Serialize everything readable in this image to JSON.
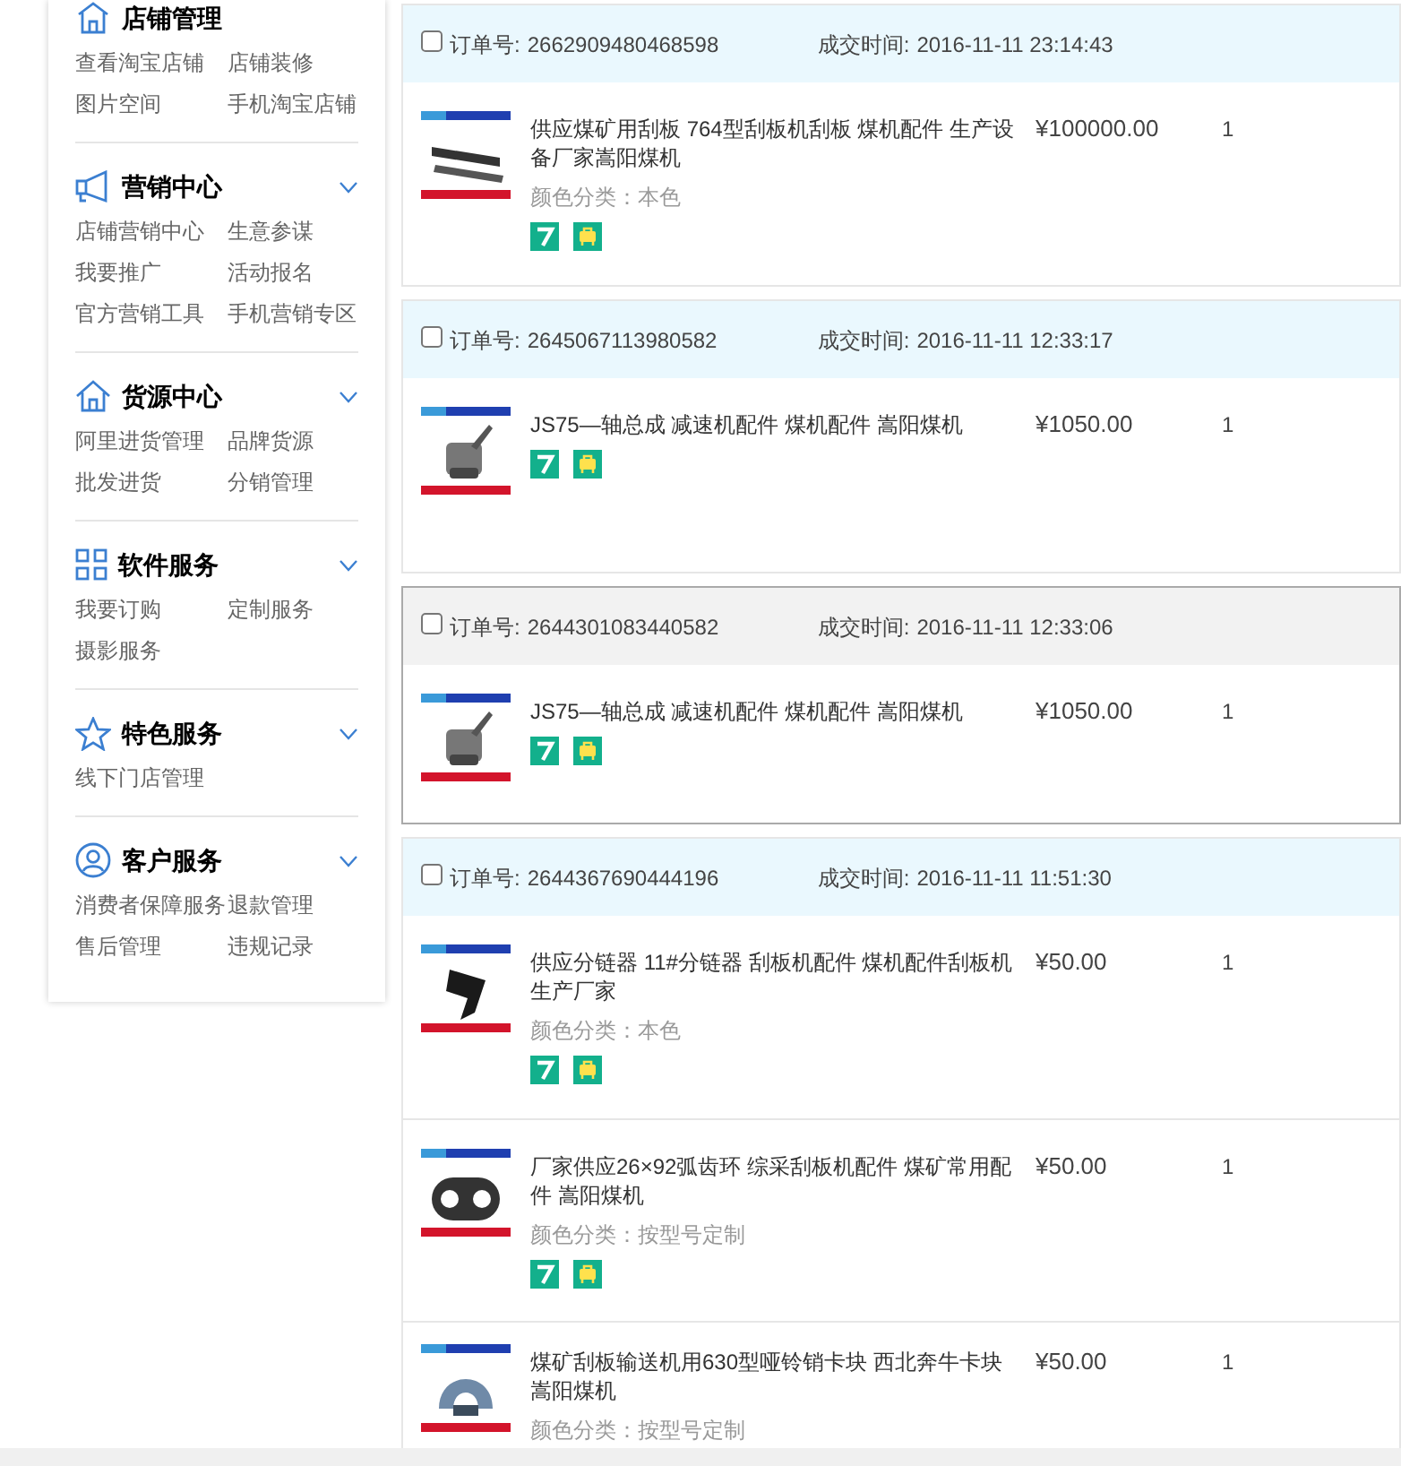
{
  "sidebar": {
    "sections": [
      {
        "kind": "shop",
        "title": "店铺管理",
        "links": [
          "查看淘宝店铺",
          "店铺装修",
          "图片空间",
          "手机淘宝店铺"
        ]
      },
      {
        "kind": "megaphone",
        "title": "营销中心",
        "links": [
          "店铺营销中心",
          "生意参谋",
          "我要推广",
          "活动报名",
          "官方营销工具",
          "手机营销专区"
        ]
      },
      {
        "kind": "house",
        "title": "货源中心",
        "links": [
          "阿里进货管理",
          "品牌货源",
          "批发进货",
          "分销管理"
        ]
      },
      {
        "kind": "grid",
        "title": "软件服务",
        "links": [
          "我要订购",
          "定制服务",
          "摄影服务"
        ]
      },
      {
        "kind": "star",
        "title": "特色服务",
        "links": [
          "线下门店管理"
        ]
      },
      {
        "kind": "person",
        "title": "客户服务",
        "links": [
          "消费者保障服务",
          "退款管理",
          "售后管理",
          "违规记录"
        ]
      }
    ]
  },
  "orders": [
    {
      "checked": false,
      "hovered": false,
      "order_label": "订单号:",
      "order_no": "2662909480468598",
      "time_label": "成交时间:",
      "time": "2016-11-11 23:14:43",
      "items": [
        {
          "kind": "plate",
          "title": "供应煤矿用刮板 764型刮板机刮板 煤机配件 生产设备厂家嵩阳煤机",
          "spec": "颜色分类：本色",
          "price": "¥100000.00",
          "qty": "1",
          "badges": [
            {
              "kind": "return7"
            },
            {
              "kind": "bag"
            }
          ]
        }
      ]
    },
    {
      "checked": false,
      "hovered": false,
      "order_label": "订单号:",
      "order_no": "2645067113980582",
      "time_label": "成交时间:",
      "time": "2016-11-11 12:33:17",
      "items": [
        {
          "kind": "shaft",
          "title": "JS75—轴总成 减速机配件 煤机配件 嵩阳煤机",
          "price": "¥1050.00",
          "qty": "1",
          "badges": [
            {
              "kind": "return7"
            },
            {
              "kind": "bag"
            }
          ]
        }
      ]
    },
    {
      "checked": false,
      "hovered": true,
      "order_label": "订单号:",
      "order_no": "2644301083440582",
      "time_label": "成交时间:",
      "time": "2016-11-11 12:33:06",
      "items": [
        {
          "kind": "shaft",
          "title": "JS75—轴总成 减速机配件 煤机配件 嵩阳煤机",
          "price": "¥1050.00",
          "qty": "1",
          "badges": [
            {
              "kind": "return7"
            },
            {
              "kind": "bag"
            }
          ]
        }
      ]
    },
    {
      "checked": false,
      "hovered": false,
      "order_label": "订单号:",
      "order_no": "2644367690444196",
      "time_label": "成交时间:",
      "time": "2016-11-11 11:51:30",
      "items": [
        {
          "kind": "hook",
          "title": "供应分链器 11#分链器 刮板机配件 煤机配件刮板机生产厂家",
          "spec": "颜色分类：本色",
          "price": "¥50.00",
          "qty": "1",
          "badges": [
            {
              "kind": "return7"
            },
            {
              "kind": "bag"
            }
          ]
        },
        {
          "kind": "ring",
          "title": "厂家供应26×92弧齿环 综采刮板机配件 煤矿常用配件 嵩阳煤机",
          "spec": "颜色分类：按型号定制",
          "price": "¥50.00",
          "qty": "1",
          "badges": [
            {
              "kind": "return7"
            },
            {
              "kind": "bag"
            }
          ]
        },
        {
          "kind": "block",
          "title": "煤矿刮板输送机用630型哑铃销卡块 西北奔牛卡块嵩阳煤机",
          "spec": "颜色分类：按型号定制",
          "price": "¥50.00",
          "qty": "1"
        }
      ]
    }
  ]
}
